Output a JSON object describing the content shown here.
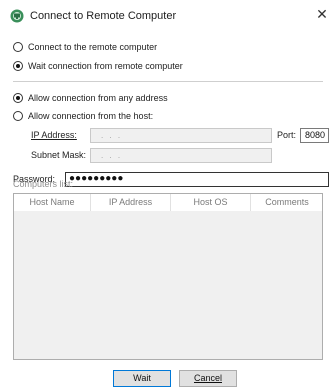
{
  "window": {
    "title": "Connect to Remote Computer",
    "close_glyph": "✕"
  },
  "mode": {
    "connect_label": "Connect to the remote computer",
    "wait_label": "Wait connection from remote computer",
    "selected": "wait"
  },
  "allow": {
    "any_label": "Allow connection from any address",
    "host_label": "Allow connection from the host:",
    "selected": "any"
  },
  "host": {
    "ip_label": "IP Address:",
    "ip_value": ". . .",
    "port_label": "Port:",
    "port_value": "8080",
    "mask_label": "Subnet Mask:",
    "mask_value": ". . ."
  },
  "password": {
    "label": "Password:",
    "masked_value": "●●●●●●●●●"
  },
  "computers": {
    "label": "Computers list:",
    "columns": [
      "Host Name",
      "IP Address",
      "Host OS",
      "Comments"
    ],
    "rows": []
  },
  "buttons": {
    "wait": "Wait",
    "cancel": "Cancel"
  },
  "icons": {
    "app": "remote-computer-app-icon",
    "close": "close-icon"
  }
}
